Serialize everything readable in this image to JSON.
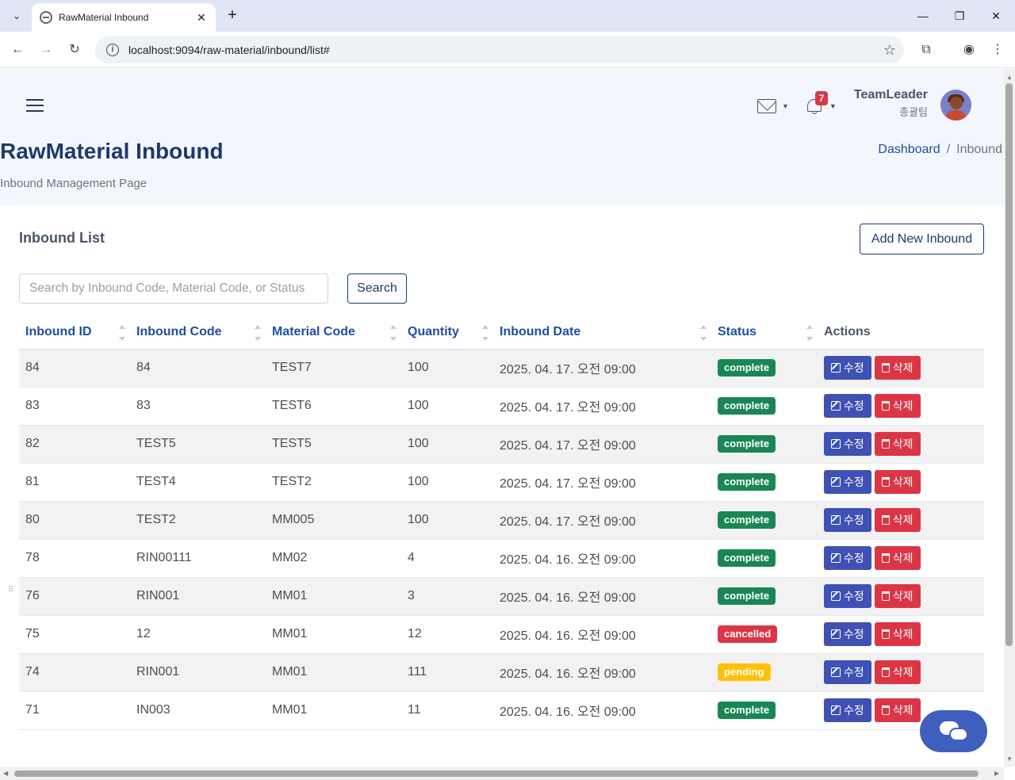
{
  "browser": {
    "tab_title": "RawMaterial Inbound",
    "url": "localhost:9094/raw-material/inbound/list#"
  },
  "header": {
    "notification_count": "7",
    "user_name": "TeamLeader",
    "user_team": "총괄팀"
  },
  "page": {
    "title": "RawMaterial Inbound",
    "subtitle": "Inbound Management Page",
    "breadcrumb": [
      "Dashboard",
      "/",
      "Inbound"
    ]
  },
  "card": {
    "title": "Inbound List",
    "add_button": "Add New Inbound",
    "search_placeholder": "Search by Inbound Code, Material Code, or Status",
    "search_button": "Search"
  },
  "table": {
    "columns": [
      "Inbound ID",
      "Inbound Code",
      "Material Code",
      "Quantity",
      "Inbound Date",
      "Status",
      "Actions"
    ],
    "edit_label": "수정",
    "delete_label": "삭제",
    "rows": [
      {
        "id": "84",
        "code": "84",
        "material": "TEST7",
        "qty": "100",
        "date": "2025. 04. 17. 오전 09:00",
        "status": "complete"
      },
      {
        "id": "83",
        "code": "83",
        "material": "TEST6",
        "qty": "100",
        "date": "2025. 04. 17. 오전 09:00",
        "status": "complete"
      },
      {
        "id": "82",
        "code": "TEST5",
        "material": "TEST5",
        "qty": "100",
        "date": "2025. 04. 17. 오전 09:00",
        "status": "complete"
      },
      {
        "id": "81",
        "code": "TEST4",
        "material": "TEST2",
        "qty": "100",
        "date": "2025. 04. 17. 오전 09:00",
        "status": "complete"
      },
      {
        "id": "80",
        "code": "TEST2",
        "material": "MM005",
        "qty": "100",
        "date": "2025. 04. 17. 오전 09:00",
        "status": "complete"
      },
      {
        "id": "78",
        "code": "RIN00111",
        "material": "MM02",
        "qty": "4",
        "date": "2025. 04. 16. 오전 09:00",
        "status": "complete"
      },
      {
        "id": "76",
        "code": "RIN001",
        "material": "MM01",
        "qty": "3",
        "date": "2025. 04. 16. 오전 09:00",
        "status": "complete"
      },
      {
        "id": "75",
        "code": "12",
        "material": "MM01",
        "qty": "12",
        "date": "2025. 04. 16. 오전 09:00",
        "status": "cancelled"
      },
      {
        "id": "74",
        "code": "RIN001",
        "material": "MM01",
        "qty": "111",
        "date": "2025. 04. 16. 오전 09:00",
        "status": "pending"
      },
      {
        "id": "71",
        "code": "IN003",
        "material": "MM01",
        "qty": "11",
        "date": "2025. 04. 16. 오전 09:00",
        "status": "complete"
      }
    ]
  }
}
